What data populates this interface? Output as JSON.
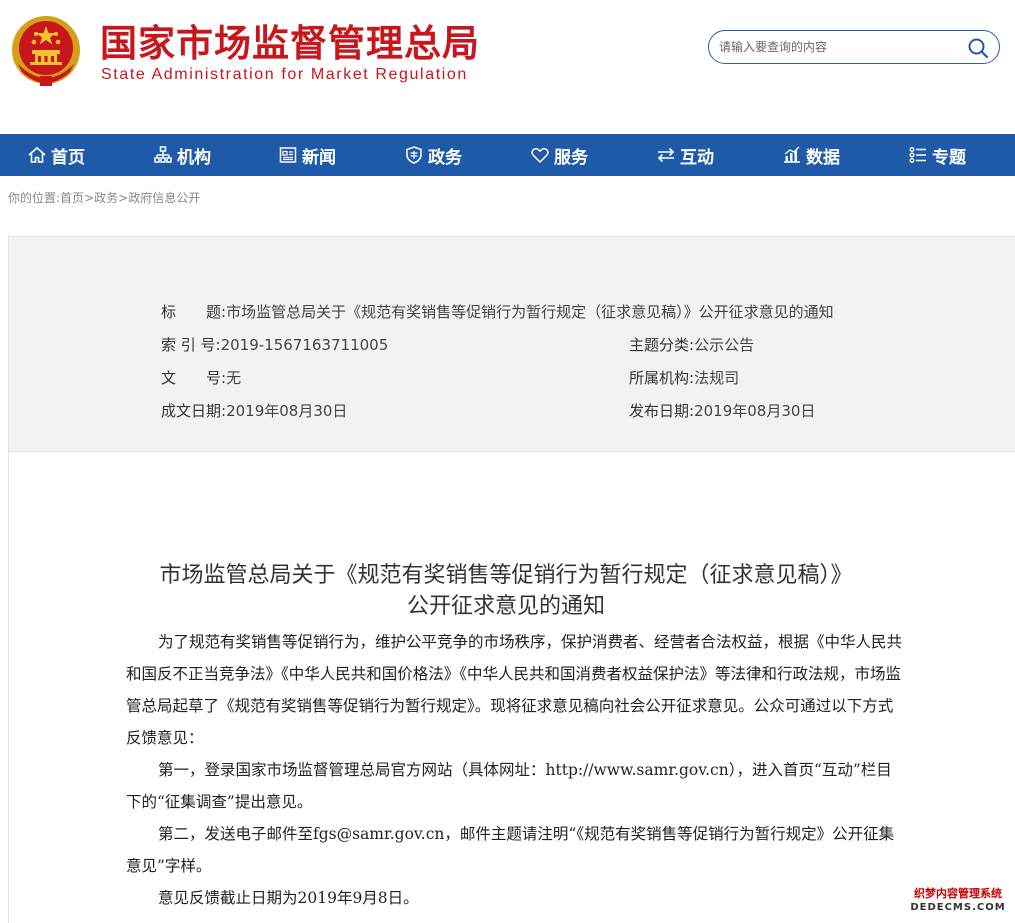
{
  "header": {
    "site_name_cn": "国家市场监督管理总局",
    "site_name_en": "State Administration for Market Regulation",
    "search_placeholder": "请输入要查询的内容"
  },
  "nav": {
    "items": [
      {
        "label": "首页",
        "icon": "home-icon"
      },
      {
        "label": "机构",
        "icon": "org-chart-icon"
      },
      {
        "label": "新闻",
        "icon": "newspaper-icon"
      },
      {
        "label": "政务",
        "icon": "shield-icon"
      },
      {
        "label": "服务",
        "icon": "heart-icon"
      },
      {
        "label": "互动",
        "icon": "exchange-icon"
      },
      {
        "label": "数据",
        "icon": "chart-icon"
      },
      {
        "label": "专题",
        "icon": "list-icon"
      }
    ]
  },
  "breadcrumb": {
    "prefix": "你的位置:",
    "items": [
      "首页",
      "政务",
      "政府信息公开"
    ],
    "separator": ">"
  },
  "meta": {
    "title_label": "标　　题:",
    "title_value": "市场监管总局关于《规范有奖销售等促销行为暂行规定（征求意见稿）》公开征求意见的通知",
    "index_label": "索 引 号:",
    "index_value": "2019-1567163711005",
    "category_label": "主题分类:",
    "category_value": "公示公告",
    "docno_label": "文　　号:",
    "docno_value": "无",
    "org_label": "所属机构:",
    "org_value": "法规司",
    "created_label": "成文日期:",
    "created_value": "2019年08月30日",
    "published_label": "发布日期:",
    "published_value": "2019年08月30日"
  },
  "article": {
    "title_line1": "市场监管总局关于《规范有奖销售等促销行为暂行规定（征求意见稿）》",
    "title_line2": "公开征求意见的通知",
    "paragraphs": [
      "为了规范有奖销售等促销行为，维护公平竞争的市场秩序，保护消费者、经营者合法权益，根据《中华人民共和国反不正当竞争法》《中华人民共和国价格法》《中华人民共和国消费者权益保护法》等法律和行政法规，市场监管总局起草了《规范有奖销售等促销行为暂行规定》。现将征求意见稿向社会公开征求意见。公众可通过以下方式反馈意见：",
      "第一，登录国家市场监督管理总局官方网站（具体网址：http://www.samr.gov.cn），进入首页“互动”栏目下的“征集调查”提出意见。",
      "第二，发送电子邮件至fgs@samr.gov.cn，邮件主题请注明“《规范有奖销售等促销行为暂行规定》公开征集意见”字样。",
      "意见反馈截止日期为2019年9月8日。"
    ]
  },
  "watermark": {
    "line1": "织梦内容管理系统",
    "line2": "DEDECMS.COM"
  },
  "colors": {
    "brand_red": "#c8161d",
    "nav_blue": "#1f5aa8"
  }
}
